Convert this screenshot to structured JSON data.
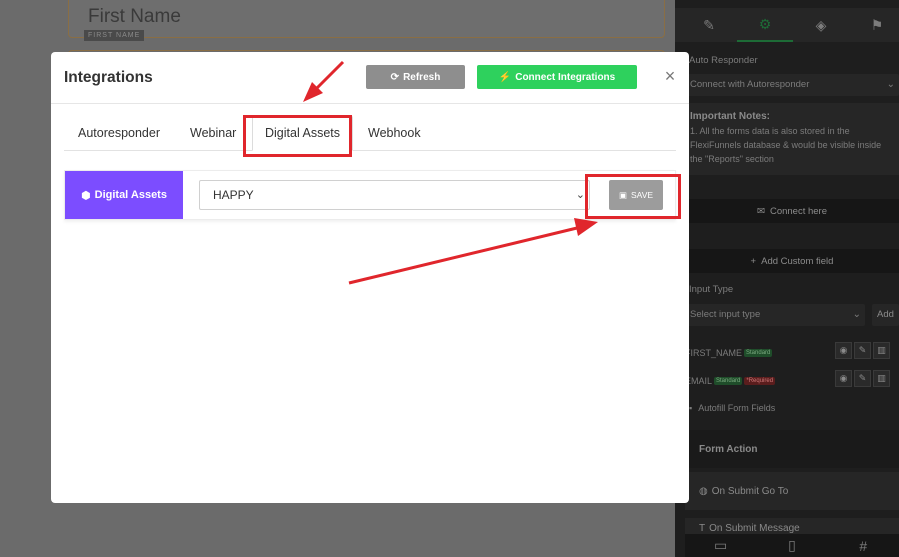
{
  "background": {
    "field_placeholder": "First Name",
    "field_tag": "FIRST NAME"
  },
  "sidebar": {
    "section_label": "Auto Responder",
    "connect_select": "Connect with Autoresponder",
    "notes_title": "Important Notes:",
    "notes_body": "1. All the forms data is also stored in the FlexiFunnels database & would be visible inside the \"Reports\" section",
    "connect_here": "Connect here",
    "add_custom_field": "Add Custom field",
    "input_type_label": "Input Type",
    "input_type_select": "Select input type",
    "add_button": "Add",
    "fields": [
      {
        "name": "FIRST_NAME",
        "badges": [
          "Standard"
        ]
      },
      {
        "name": "EMAIL",
        "badges": [
          "Standard",
          "*Required"
        ]
      }
    ],
    "autofill_label": "Autofill Form Fields",
    "form_action": "Form Action",
    "on_submit_go_to": "On Submit Go To",
    "on_submit_message": "On Submit Message"
  },
  "modal": {
    "title": "Integrations",
    "refresh_label": "Refresh",
    "connect_label": "Connect Integrations",
    "close_symbol": "×",
    "tabs": [
      {
        "label": "Autoresponder",
        "active": false
      },
      {
        "label": "Webinar",
        "active": false
      },
      {
        "label": "Digital Assets",
        "active": true
      },
      {
        "label": "Webhook",
        "active": false
      }
    ],
    "row": {
      "label": "Digital Assets",
      "selected_value": "HAPPY",
      "save_label": "SAVE"
    }
  },
  "colors": {
    "accent_purple": "#7c4dff",
    "connect_green": "#2ed15d",
    "refresh_gray": "#8e8e8e",
    "annotation_red": "#e0262c"
  }
}
